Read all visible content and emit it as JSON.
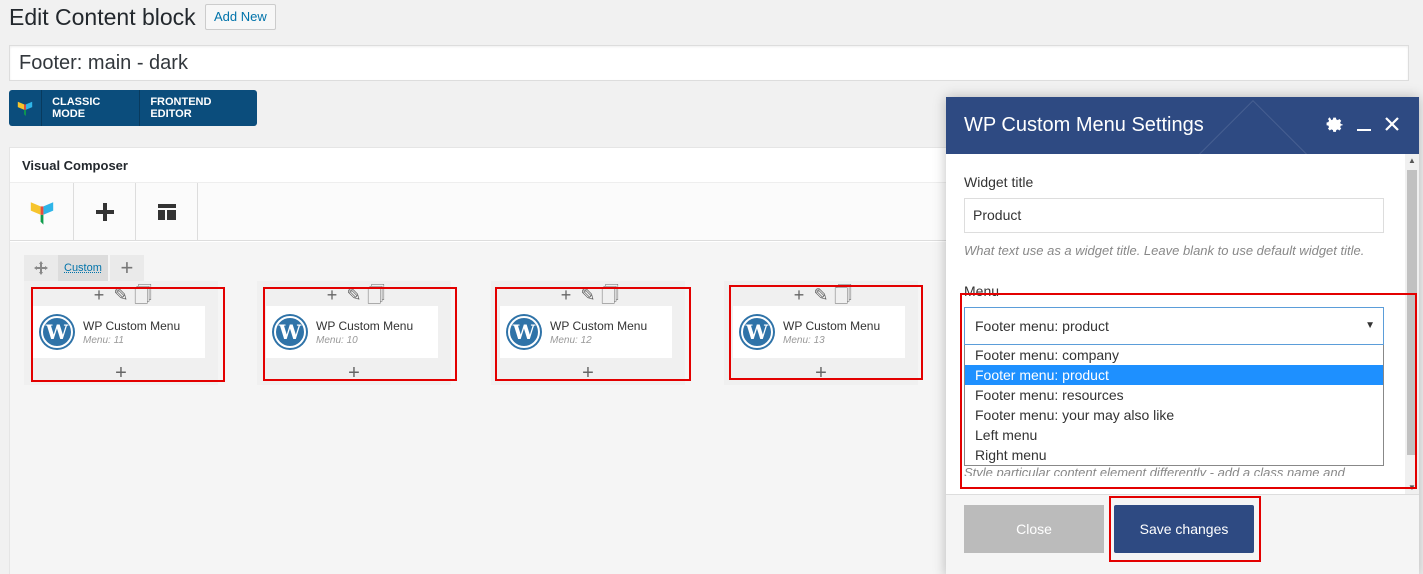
{
  "page": {
    "title": "Edit Content block",
    "add_new": "Add New"
  },
  "post_title": "Footer: main - dark",
  "mode_bar": {
    "classic": "CLASSIC MODE",
    "frontend": "FRONTEND EDITOR"
  },
  "vc": {
    "header": "Visual Composer",
    "row_label": "Custom",
    "elements": [
      {
        "title": "WP Custom Menu",
        "sub": "Menu: 11"
      },
      {
        "title": "WP Custom Menu",
        "sub": "Menu: 10"
      },
      {
        "title": "WP Custom Menu",
        "sub": "Menu: 12"
      },
      {
        "title": "WP Custom Menu",
        "sub": "Menu: 13"
      }
    ]
  },
  "modal": {
    "title": "WP Custom Menu Settings",
    "widget_title_label": "Widget title",
    "widget_title_value": "Product",
    "widget_title_help": "What text use as a widget title. Leave blank to use default widget title.",
    "menu_label": "Menu",
    "menu_selected": "Footer menu: product",
    "menu_options": [
      "Footer menu: company",
      "Footer menu: product",
      "Footer menu: resources",
      "Footer menu: your may also like",
      "Left menu",
      "Right menu"
    ],
    "extra_help_cut": "Style particular content element differently - add a class name and",
    "close_label": "Close",
    "save_label": "Save changes"
  },
  "colors": {
    "modal_header": "#2e4a82",
    "highlight": "#e30000",
    "mode_bar": "#0b4d7c",
    "selected_option": "#1e90ff"
  }
}
